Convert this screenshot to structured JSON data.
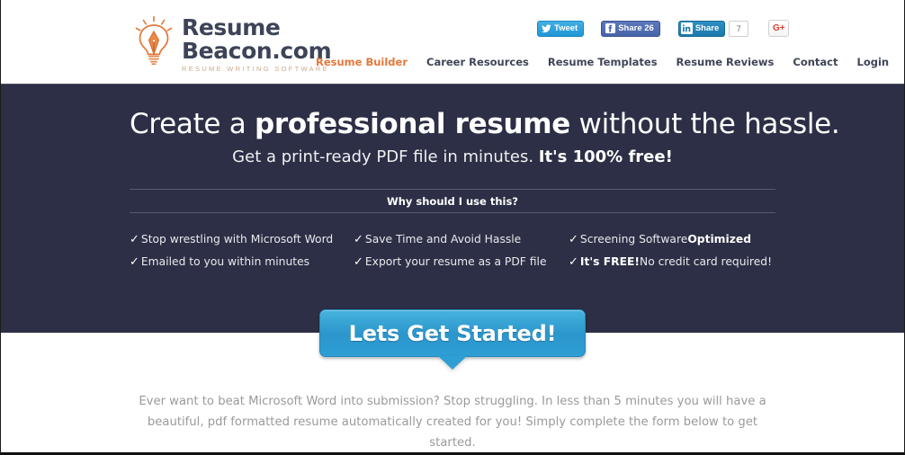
{
  "header": {
    "logo": {
      "icon": "lightbulb-pen-icon",
      "line1": "Resume",
      "line2": "Beacon.com",
      "tagline": "RESUME WRITING SOFTWARE",
      "color_text": "#3d4458",
      "color_tagline": "#c8a98f",
      "color_icon": "#e2783a"
    },
    "social": {
      "tweet": {
        "icon": "twitter-bird-icon",
        "label": "Tweet",
        "color": "#2196d6"
      },
      "facebook": {
        "icon": "facebook-f-icon",
        "label": "Share 26",
        "color": "#4864a8"
      },
      "linkedin": {
        "icon": "linkedin-in-icon",
        "label": "Share",
        "count": "7",
        "color": "#1b79ad"
      },
      "googleplus": {
        "icon": "google-plus-icon",
        "label": "G+",
        "color": "#d94235"
      }
    },
    "nav": [
      {
        "label": "Resume Builder",
        "active": true
      },
      {
        "label": "Career Resources",
        "active": false
      },
      {
        "label": "Resume Templates",
        "active": false
      },
      {
        "label": "Resume Reviews",
        "active": false
      },
      {
        "label": "Contact",
        "active": false
      },
      {
        "label": "Login",
        "active": false
      }
    ],
    "nav_active_color": "#e2783a"
  },
  "hero": {
    "background_color": "#2c2f45",
    "headline_part1": "Create a ",
    "headline_bold": "professional resume",
    "headline_part2": " without the hassle.",
    "sub_part1": "Get a print-ready PDF file in minutes. ",
    "sub_bold": "It's 100% free!",
    "why_label": "Why should I use this?",
    "check_glyph": "✓",
    "features": {
      "column1": [
        {
          "text": "Stop wrestling with Microsoft Word",
          "bold": ""
        },
        {
          "text": "Emailed to you within minutes",
          "bold": ""
        }
      ],
      "column2": [
        {
          "text": "Save Time and Avoid Hassle",
          "bold": ""
        },
        {
          "text": "Export your resume as a PDF file",
          "bold": ""
        }
      ],
      "column3": [
        {
          "pre": "Screening Software ",
          "bold": "Optimized",
          "post": ""
        },
        {
          "pre": "",
          "bold": "It's FREE!",
          "post": " No credit card required!"
        }
      ]
    }
  },
  "cta": {
    "label": "Lets Get Started!",
    "color": "#2b96cc"
  },
  "bottom": {
    "blurb": "Ever want to beat Microsoft Word into submission? Stop struggling. In less than 5 minutes you will have a beautiful, pdf formatted resume automatically created for you! Simply complete the form below to get started."
  }
}
